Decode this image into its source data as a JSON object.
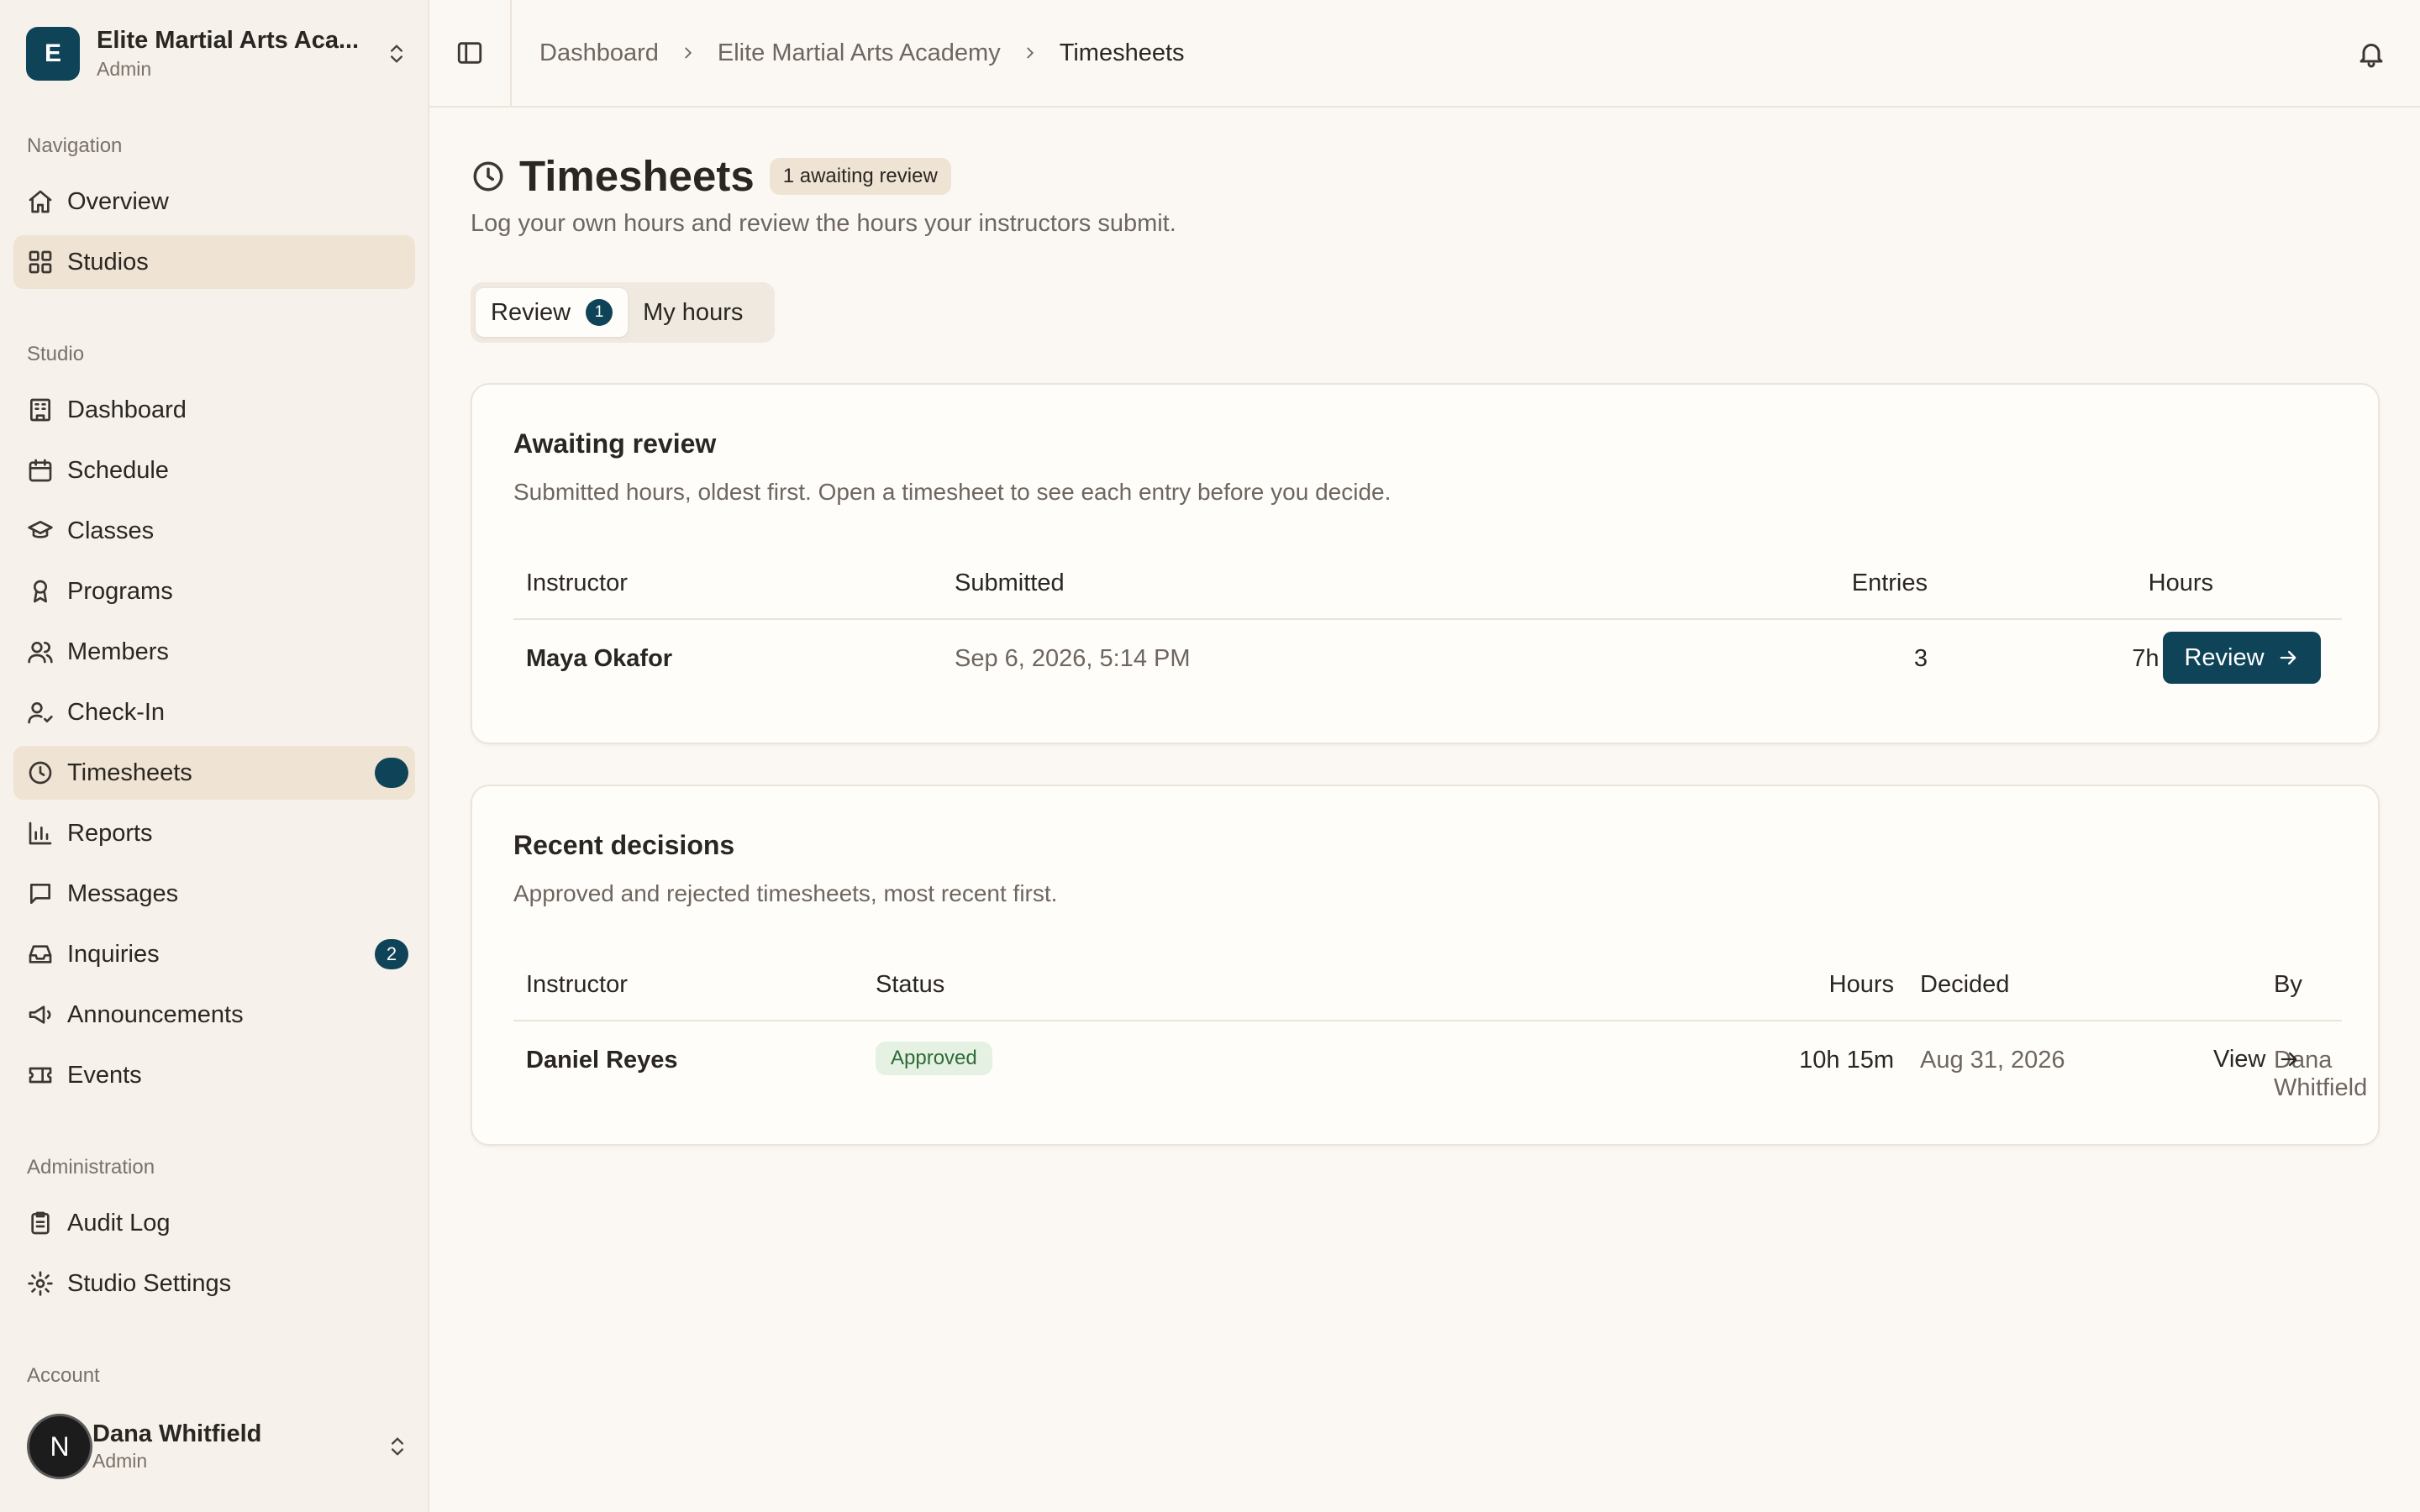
{
  "org": {
    "initial": "E",
    "name": "Elite Martial Arts Aca...",
    "role": "Admin"
  },
  "sidebar": {
    "sections": {
      "navigation": "Navigation",
      "studio": "Studio",
      "administration": "Administration",
      "account": "Account"
    },
    "items": {
      "overview": "Overview",
      "studios": "Studios",
      "dashboard": "Dashboard",
      "schedule": "Schedule",
      "classes": "Classes",
      "programs": "Programs",
      "members": "Members",
      "checkin": "Check-In",
      "timesheets": "Timesheets",
      "reports": "Reports",
      "messages": "Messages",
      "inquiries": "Inquiries",
      "inquiries_badge": "2",
      "announcements": "Announcements",
      "events": "Events",
      "audit_log": "Audit Log",
      "studio_settings": "Studio Settings"
    }
  },
  "account": {
    "initial": "N",
    "name": "Dana Whitfield",
    "role": "Admin"
  },
  "breadcrumb": [
    "Dashboard",
    "Elite Martial Arts Academy",
    "Timesheets"
  ],
  "page": {
    "title": "Timesheets",
    "pill": "1 awaiting review",
    "subtitle": "Log your own hours and review the hours your instructors submit."
  },
  "tabs": {
    "review": "Review",
    "review_count": "1",
    "my_hours": "My hours"
  },
  "awaiting": {
    "title": "Awaiting review",
    "desc": "Submitted hours, oldest first. Open a timesheet to see each entry before you decide.",
    "headers": {
      "instructor": "Instructor",
      "submitted": "Submitted",
      "entries": "Entries",
      "hours": "Hours"
    },
    "rows": [
      {
        "instructor": "Maya Okafor",
        "submitted": "Sep 6, 2026, 5:14 PM",
        "entries": "3",
        "hours": "7h 30m",
        "action": "Review"
      }
    ]
  },
  "decisions": {
    "title": "Recent decisions",
    "desc": "Approved and rejected timesheets, most recent first.",
    "headers": {
      "instructor": "Instructor",
      "status": "Status",
      "hours": "Hours",
      "decided": "Decided",
      "by": "By"
    },
    "rows": [
      {
        "instructor": "Daniel Reyes",
        "status": "Approved",
        "hours": "10h 15m",
        "decided": "Aug 31, 2026",
        "by": "Dana Whitfield",
        "action": "View"
      }
    ]
  },
  "colors": {
    "accent": "#0f4458",
    "active_bg": "#efe3d4",
    "approved_bg": "#e5f1e3",
    "approved_fg": "#2f6b35"
  }
}
